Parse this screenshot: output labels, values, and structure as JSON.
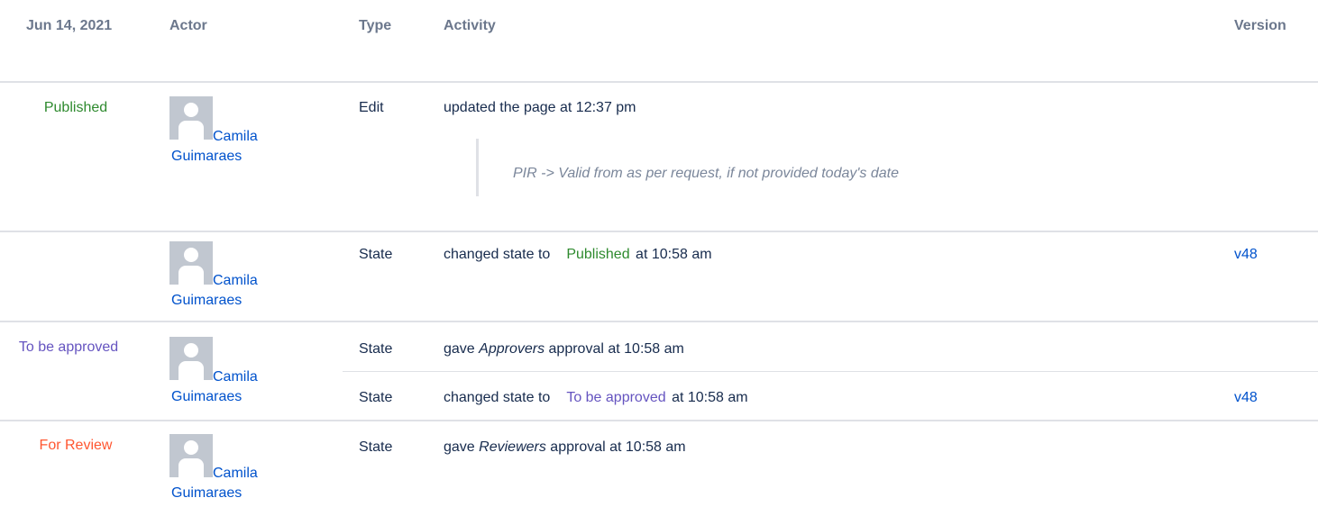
{
  "header": {
    "date": "Jun 14, 2021",
    "actor": "Actor",
    "type": "Type",
    "activity": "Activity",
    "version": "Version"
  },
  "colors": {
    "published": "#2e8a2e",
    "to_be_approved": "#6554c0",
    "for_review": "#ff5630",
    "link": "#0052cc",
    "header": "#6b778c"
  },
  "groups": [
    {
      "state": "Published",
      "actor": "Camila Guimaraes",
      "avatar_icon": "user-avatar-icon",
      "entries": [
        {
          "type": "Edit",
          "activity": "updated the page at 12:37 pm",
          "comment": "PIR -> Valid from as per request, if not provided today's date",
          "version": ""
        }
      ]
    },
    {
      "state": "",
      "actor": "Camila Guimaraes",
      "avatar_icon": "user-avatar-icon",
      "entries": [
        {
          "type": "State",
          "activity_prefix": "changed state to",
          "activity_state": "Published",
          "activity_suffix": "at 10:58 am",
          "version": "v48"
        }
      ]
    },
    {
      "state": "To be approved",
      "actor": "Camila Guimaraes",
      "avatar_icon": "user-avatar-icon",
      "entries": [
        {
          "type": "State",
          "activity_prefix": "gave",
          "activity_group": "Approvers",
          "activity_suffix": "approval at 10:58 am",
          "version": ""
        },
        {
          "type": "State",
          "activity_prefix": "changed state to",
          "activity_state": "To be approved",
          "activity_suffix": "at 10:58 am",
          "version": "v48"
        }
      ]
    },
    {
      "state": "For Review",
      "actor": "Camila Guimaraes",
      "avatar_icon": "user-avatar-icon",
      "entries": [
        {
          "type": "State",
          "activity_prefix": "gave",
          "activity_group": "Reviewers",
          "activity_suffix": "approval at 10:58 am",
          "version": ""
        }
      ]
    }
  ]
}
